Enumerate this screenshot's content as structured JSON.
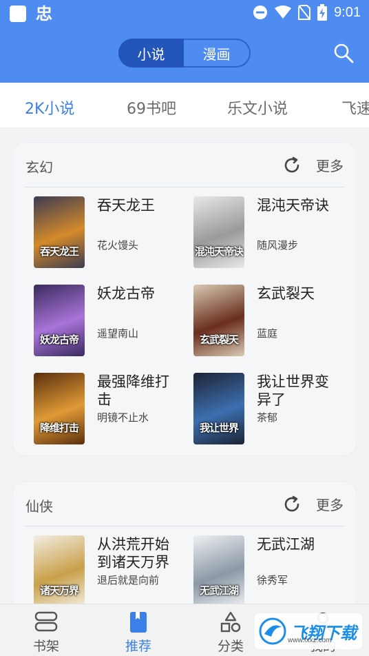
{
  "status_bar": {
    "app_glyph": "忠",
    "time": "9:01"
  },
  "header": {
    "segments": [
      "小说",
      "漫画"
    ],
    "active_segment": 0
  },
  "tabs": [
    "2K小说",
    "69书吧",
    "乐文小说",
    "飞速"
  ],
  "sections": [
    {
      "title": "玄幻",
      "more_label": "更多",
      "books": [
        {
          "title": "吞天龙王",
          "author": "花火馒头",
          "cover_text": "吞天龙王",
          "cover_colors": [
            "#3c3b52",
            "#d48a2a"
          ]
        },
        {
          "title": "混沌天帝诀",
          "author": "随风漫步",
          "cover_text": "混沌天帝诀",
          "cover_colors": [
            "#e8e8e8",
            "#9a9a9a"
          ]
        },
        {
          "title": "妖龙古帝",
          "author": "遥望南山",
          "cover_text": "妖龙古帝",
          "cover_colors": [
            "#3a2a5e",
            "#a874d8"
          ]
        },
        {
          "title": "玄武裂天",
          "author": "蓝庭",
          "cover_text": "玄武裂天",
          "cover_colors": [
            "#d8cbb4",
            "#6a2e1e"
          ]
        },
        {
          "title": "最强降维打击",
          "author": "明镜不止水",
          "cover_text": "降维打击",
          "cover_colors": [
            "#5a2f0e",
            "#e09a36"
          ]
        },
        {
          "title": "我让世界变异了",
          "author": "茶郁",
          "cover_text": "我让世界",
          "cover_colors": [
            "#1d2333",
            "#3c6fb0"
          ]
        }
      ]
    },
    {
      "title": "仙侠",
      "more_label": "更多",
      "books": [
        {
          "title": "从洪荒开始到诸天万界",
          "author": "退后就是向前",
          "cover_text": "诸天万界",
          "cover_colors": [
            "#f3ede2",
            "#c9a04a"
          ]
        },
        {
          "title": "无武江湖",
          "author": "徐秀军",
          "cover_text": "无武江湖",
          "cover_colors": [
            "#eef0f2",
            "#8b98a6"
          ]
        }
      ]
    }
  ],
  "bottom_nav": {
    "items": [
      {
        "label": "书架",
        "icon": "bookshelf-icon"
      },
      {
        "label": "推荐",
        "icon": "book-icon"
      },
      {
        "label": "分类",
        "icon": "category-icon"
      },
      {
        "label": "我的",
        "icon": "user-icon"
      }
    ],
    "active": 1
  },
  "watermark": {
    "text": "飞翔下载",
    "sub": "www.fxxz.com"
  },
  "colors": {
    "accent": "#4e8cf2",
    "tab_active": "#3a80e8"
  }
}
